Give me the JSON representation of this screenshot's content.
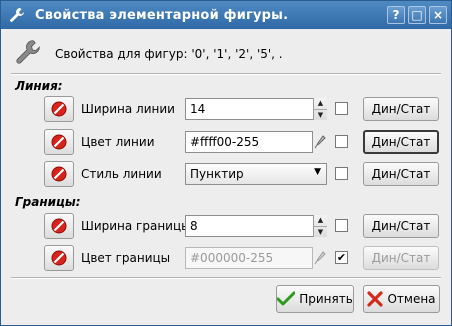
{
  "window": {
    "title": "Свойства элементарной фигуры."
  },
  "titlebar_buttons": {
    "help": "?",
    "maximize": "□",
    "close": "×"
  },
  "header": {
    "text": "Свойства для фигур: '0', '1', '2', '5', ."
  },
  "sections": {
    "line": "Линия:",
    "border": "Границы:"
  },
  "rows": {
    "line_width": {
      "label": "Ширина линии",
      "value": "14",
      "checked": false,
      "button": "Дин/Стат"
    },
    "line_color": {
      "label": "Цвет линии",
      "value": "#ffff00-255",
      "checked": false,
      "button": "Дин/Стат"
    },
    "line_style": {
      "label": "Стиль линии",
      "value": "Пунктир",
      "checked": false,
      "button": "Дин/Стат"
    },
    "border_width": {
      "label": "Ширина границы",
      "value": "8",
      "checked": false,
      "button": "Дин/Стат"
    },
    "border_color": {
      "label": "Цвет границы",
      "value": "#000000-255",
      "checked": true,
      "button": "Дин/Стат"
    }
  },
  "check_mark": "✔",
  "footer": {
    "apply": "Принять",
    "cancel": "Отмена"
  },
  "colors": {
    "title_bar": "#3a74b0",
    "window_bg": "#ededed",
    "apply_icon": "#2e9b1e",
    "cancel_icon": "#d42a1a",
    "toggle_icon": "#d8221a"
  },
  "icons": {
    "window": "wrench-icon",
    "toggle": "no-entry-icon",
    "picker": "pipette-icon",
    "apply": "checkmark-icon",
    "cancel": "cross-icon"
  }
}
